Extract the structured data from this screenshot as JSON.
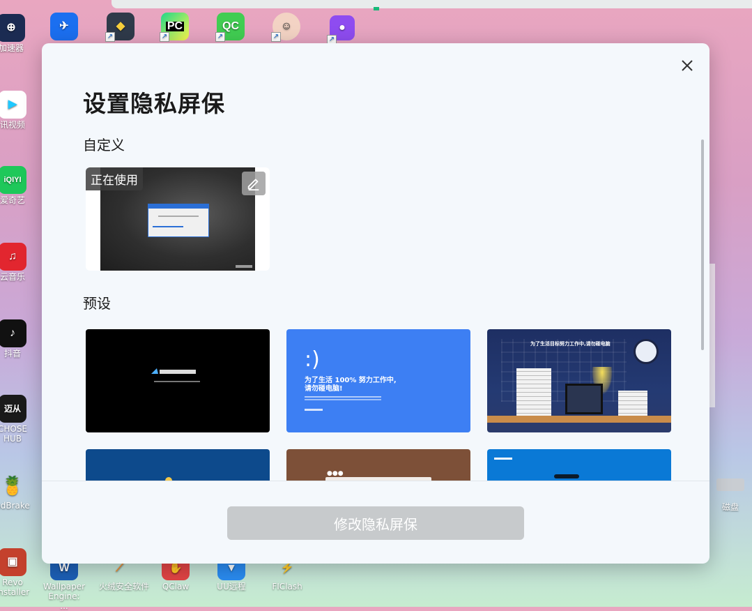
{
  "desktop": {
    "icons": [
      {
        "label": "加速器",
        "color": "#1b2b52"
      },
      {
        "label": "讯视频",
        "color": "#ffffff"
      },
      {
        "label": "爱奇艺",
        "color": "#1ec85a"
      },
      {
        "label": "云音乐",
        "color": "#e2262f"
      },
      {
        "label": "抖音",
        "color": "#111111"
      },
      {
        "label": "CHOSE HUB",
        "color": "#1a1a1a"
      },
      {
        "label": "ndBrake",
        "color": "#e8aa3c"
      },
      {
        "label": "Revo Installer",
        "color": "#c4412d"
      },
      {
        "label": "Wallpaper Engine: ...",
        "color": "#1c5fb5"
      },
      {
        "label": "火绒安全软件",
        "color": "#f48b2a"
      },
      {
        "label": "QClaw",
        "color": "#e04444"
      },
      {
        "label": "UU远程",
        "color": "#2a8bf0"
      },
      {
        "label": "FIClash",
        "color": "#2a6fd6"
      },
      {
        "label": "磁盘",
        "color": "#c9cdd2"
      }
    ],
    "top_icons": [
      {
        "name": "qq-icon",
        "color": "#1b6ff0",
        "text": ""
      },
      {
        "name": "python-icon",
        "color": "#2f6e9b",
        "text": ""
      },
      {
        "name": "pycharm-icon",
        "color": "#14c18a",
        "text": "PC"
      },
      {
        "name": "qt-creator-icon",
        "color": "#41cd52",
        "text": "QC"
      },
      {
        "name": "avatar-icon",
        "color": "#f3d3c4",
        "text": ""
      },
      {
        "name": "ghost-app-icon",
        "color": "#8e4cf0",
        "text": ""
      }
    ]
  },
  "modal": {
    "title": "设置隐私屏保",
    "custom_section_label": "自定义",
    "in_use_badge": "正在使用",
    "preset_section_label": "预设",
    "preset2_text": "为了生活 100% 努力工作中,\n请勿碰电脑!",
    "preset2_face": ":)",
    "preset3_headline": "为了生活目标努力工作中,请勿碰电脑",
    "primary_button": "修改隐私屏保"
  }
}
